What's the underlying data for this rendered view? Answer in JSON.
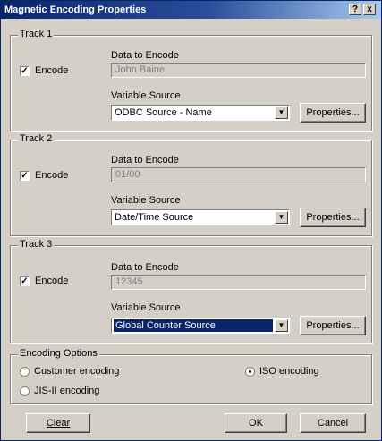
{
  "window": {
    "title": "Magnetic Encoding Properties",
    "help_btn": "?",
    "close_btn": "x"
  },
  "tracks": [
    {
      "label": "Track 1",
      "encode_label": "Encode",
      "encode_checked": "✓",
      "data_label": "Data to Encode",
      "data_value": "John Baine",
      "source_label": "Variable Source",
      "source_value": "ODBC Source - Name",
      "properties_label": "Properties..."
    },
    {
      "label": "Track 2",
      "encode_label": "Encode",
      "encode_checked": "✓",
      "data_label": "Data to Encode",
      "data_value": "01/00",
      "source_label": "Variable Source",
      "source_value": "Date/Time Source",
      "properties_label": "Properties..."
    },
    {
      "label": "Track 3",
      "encode_label": "Encode",
      "encode_checked": "✓",
      "data_label": "Data to Encode",
      "data_value": "12345",
      "source_label": "Variable Source",
      "source_value": "Global Counter Source",
      "properties_label": "Properties..."
    }
  ],
  "options": {
    "label": "Encoding Options",
    "custom": "Customer encoding",
    "iso": "ISO encoding",
    "jis": "JIS-II encoding",
    "selected": "iso"
  },
  "buttons": {
    "clear": "Clear",
    "ok": "OK",
    "cancel": "Cancel"
  },
  "arrow_glyph": "▼"
}
